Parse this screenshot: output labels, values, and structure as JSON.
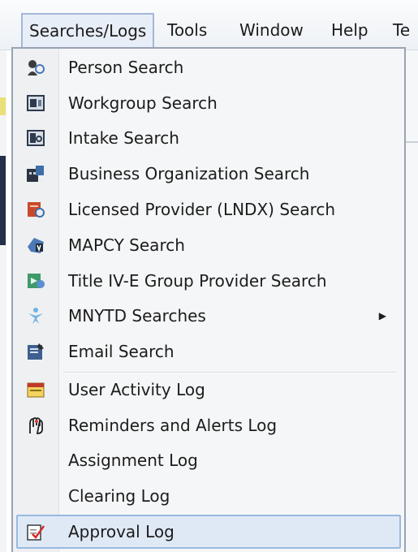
{
  "menubar": {
    "items": [
      {
        "label": "Searches/Logs",
        "open": true
      },
      {
        "label": "Tools"
      },
      {
        "label": "Window"
      },
      {
        "label": "Help"
      },
      {
        "label": "Te"
      }
    ]
  },
  "dropdown": {
    "items": [
      {
        "label": "Person Search",
        "icon": "person-search-icon"
      },
      {
        "label": "Workgroup Search",
        "icon": "workgroup-search-icon"
      },
      {
        "label": "Intake Search",
        "icon": "intake-search-icon"
      },
      {
        "label": "Business Organization Search",
        "icon": "business-organization-icon"
      },
      {
        "label": "Licensed Provider (LNDX) Search",
        "icon": "licensed-provider-icon"
      },
      {
        "label": "MAPCY Search",
        "icon": "mapcy-icon"
      },
      {
        "label": "Title IV-E Group Provider Search",
        "icon": "title-ive-icon"
      },
      {
        "label": "MNYTD Searches",
        "icon": "mnytd-icon",
        "has_submenu": true
      },
      {
        "label": "Email Search",
        "icon": "email-search-icon"
      },
      {
        "label": "User Activity Log",
        "icon": "user-activity-log-icon"
      },
      {
        "label": "Reminders and Alerts Log",
        "icon": "reminders-alerts-icon"
      },
      {
        "label": "Assignment Log",
        "icon": null
      },
      {
        "label": "Clearing Log",
        "icon": null
      },
      {
        "label": "Approval Log",
        "icon": "approval-log-icon",
        "highlighted": true
      }
    ],
    "submenu_arrow": "▶"
  },
  "colors": {
    "highlight_bg": "#dfe9f6",
    "highlight_border": "#99b9de",
    "menu_border": "#97a3b3"
  }
}
